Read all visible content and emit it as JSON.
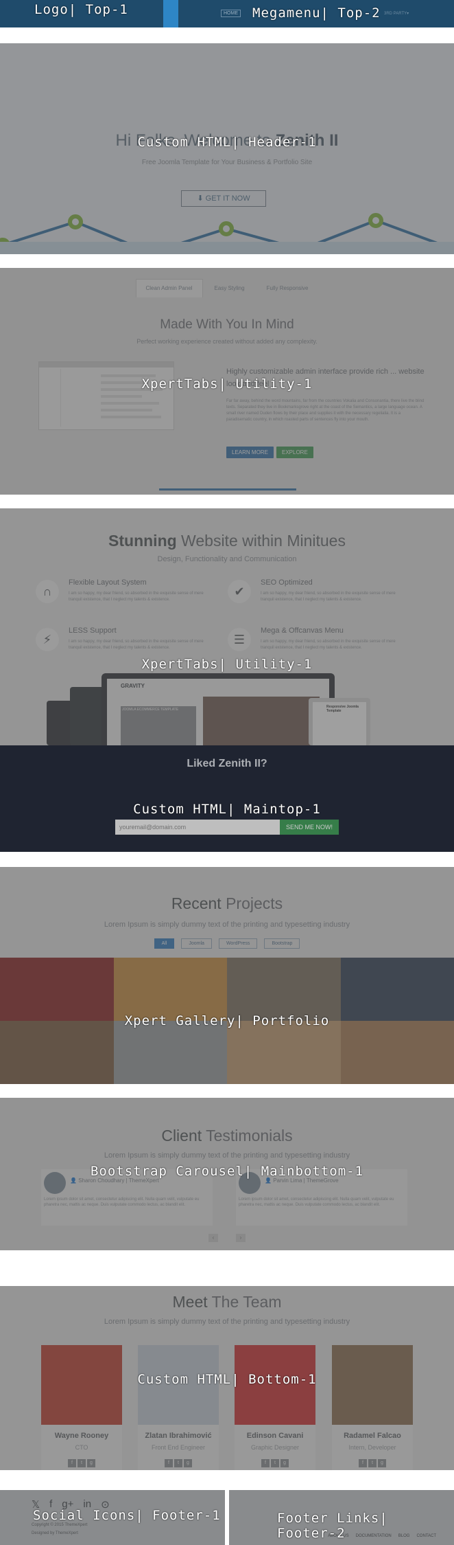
{
  "sections": {
    "top": {
      "label": "Logo| Top-1",
      "label2": "Megamenu| Top-2",
      "home": "HOME",
      "menu_extra": "3RD PARTY▾"
    },
    "header": {
      "label": "Custom HTML| Header-1",
      "title_pre": "Hi Folks, Welcome to ",
      "title_bold": "Zenith II",
      "subtitle": "Free Joomla Template for Your Business & Portfolio Site",
      "cta": "GET IT NOW"
    },
    "utility1": {
      "label": "XpertTabs| Utility-1",
      "tabs": [
        "Clean Admin Panel",
        "Easy Styling",
        "Fully Responsive"
      ],
      "heading": "Made With You In Mind",
      "lead": "Perfect working experience created without added any complexity.",
      "para": "Highly customizable admin interface provide rich ... website look and feel",
      "small": "Far far away, behind the word mountains, far from the countries Vokalia and Consonantia, there live the blind texts. Separated they live in Bookmarksgrove right at the coast of the Semantics, a large language ocean. A small river named Duden flows by their place and supplies it with the necessary regelialia. It is a paradisematic country, in which roasted parts of sentences fly into your mouth.",
      "learn_more": "LEARN MORE",
      "explore": "EXPLORE"
    },
    "utility2": {
      "label": "XpertTabs| Utility-1",
      "heading_bold": "Stunning",
      "heading_rest": " Website within Minitues",
      "lead": "Design, Functionality and Communication",
      "features": [
        {
          "title": "Flexible Layout System",
          "icon": "magnet-icon"
        },
        {
          "title": "SEO Optimized",
          "icon": "check-icon"
        },
        {
          "title": "LESS Support",
          "icon": "bolt-icon"
        },
        {
          "title": "Mega & Offcanvas Menu",
          "icon": "menu-icon"
        }
      ],
      "feature_desc": "I am so happy, my dear friend, so absorbed in the exquisite sense of mere tranquil existence, that I neglect my talents & existence.",
      "device_title": "GRAVITY",
      "device_banner": "JOOMLA ECOMMERCE TEMPLATE",
      "tablet_title": "Responsive Joomla Template"
    },
    "maintop": {
      "label": "Custom HTML| Maintop-1",
      "title": "Liked Zenith II?",
      "placeholder": "youremail@domain.com",
      "button": "SEND ME NOW!"
    },
    "portfolio": {
      "label": "Xpert Gallery| Portfolio",
      "heading_bold": "Recent",
      "heading_rest": " Projects",
      "lead": "Lorem Ipsum is simply dummy text of the printing and typesetting industry",
      "filters": [
        "All",
        "Joomla",
        "WordPress",
        "Bootstrap"
      ]
    },
    "testimonials": {
      "label": "Bootstrap Carousel| Mainbottom-1",
      "heading_bold": "Client",
      "heading_rest": " Testimonials",
      "lead": "Lorem Ipsum is simply dummy text of the printing and typesetting industry",
      "quotes": [
        {
          "name": "Sharon Choudhary",
          "company": "ThemeXpert"
        },
        {
          "name": "Parvin Lima",
          "company": "ThemeGrove"
        }
      ],
      "quote_text": "Lorem ipsum dolor sit amet, consectetur adipiscing elit. Nulla quam velit, vulputate eu pharetra nec, mattis ac neque. Duis vulputate commodo lectus, ac blandit elit.",
      "prev": "‹",
      "next": "›"
    },
    "team": {
      "label": "Custom HTML| Bottom-1",
      "heading_bold": "Meet",
      "heading_rest": " The Team",
      "lead": "Lorem Ipsum is simply dummy text of the printing and typesetting industry",
      "members": [
        {
          "name": "Wayne Rooney",
          "role": "CTO"
        },
        {
          "name": "Zlatan Ibrahimović",
          "role": "Front End Engineer"
        },
        {
          "name": "Edinson Cavani",
          "role": "Graphic Designer"
        },
        {
          "name": "Radamel Falcao",
          "role": "Intern, Developer"
        }
      ]
    },
    "footer1": {
      "label": "Social Icons| Footer-1",
      "copyright": "Copyright © 2015 ThemeXpert",
      "designed_by": "Designed by ThemeXpert"
    },
    "footer2": {
      "label": "Footer Links| Footer-2",
      "links": [
        "ABOUT US",
        "DOCUMENTATION",
        "BLOG",
        "CONTACT"
      ]
    }
  },
  "colors": {
    "accent": "#2f6fa8",
    "green": "#3f9a53",
    "topbar": "#1f4b6b",
    "overlay": "#505050"
  }
}
